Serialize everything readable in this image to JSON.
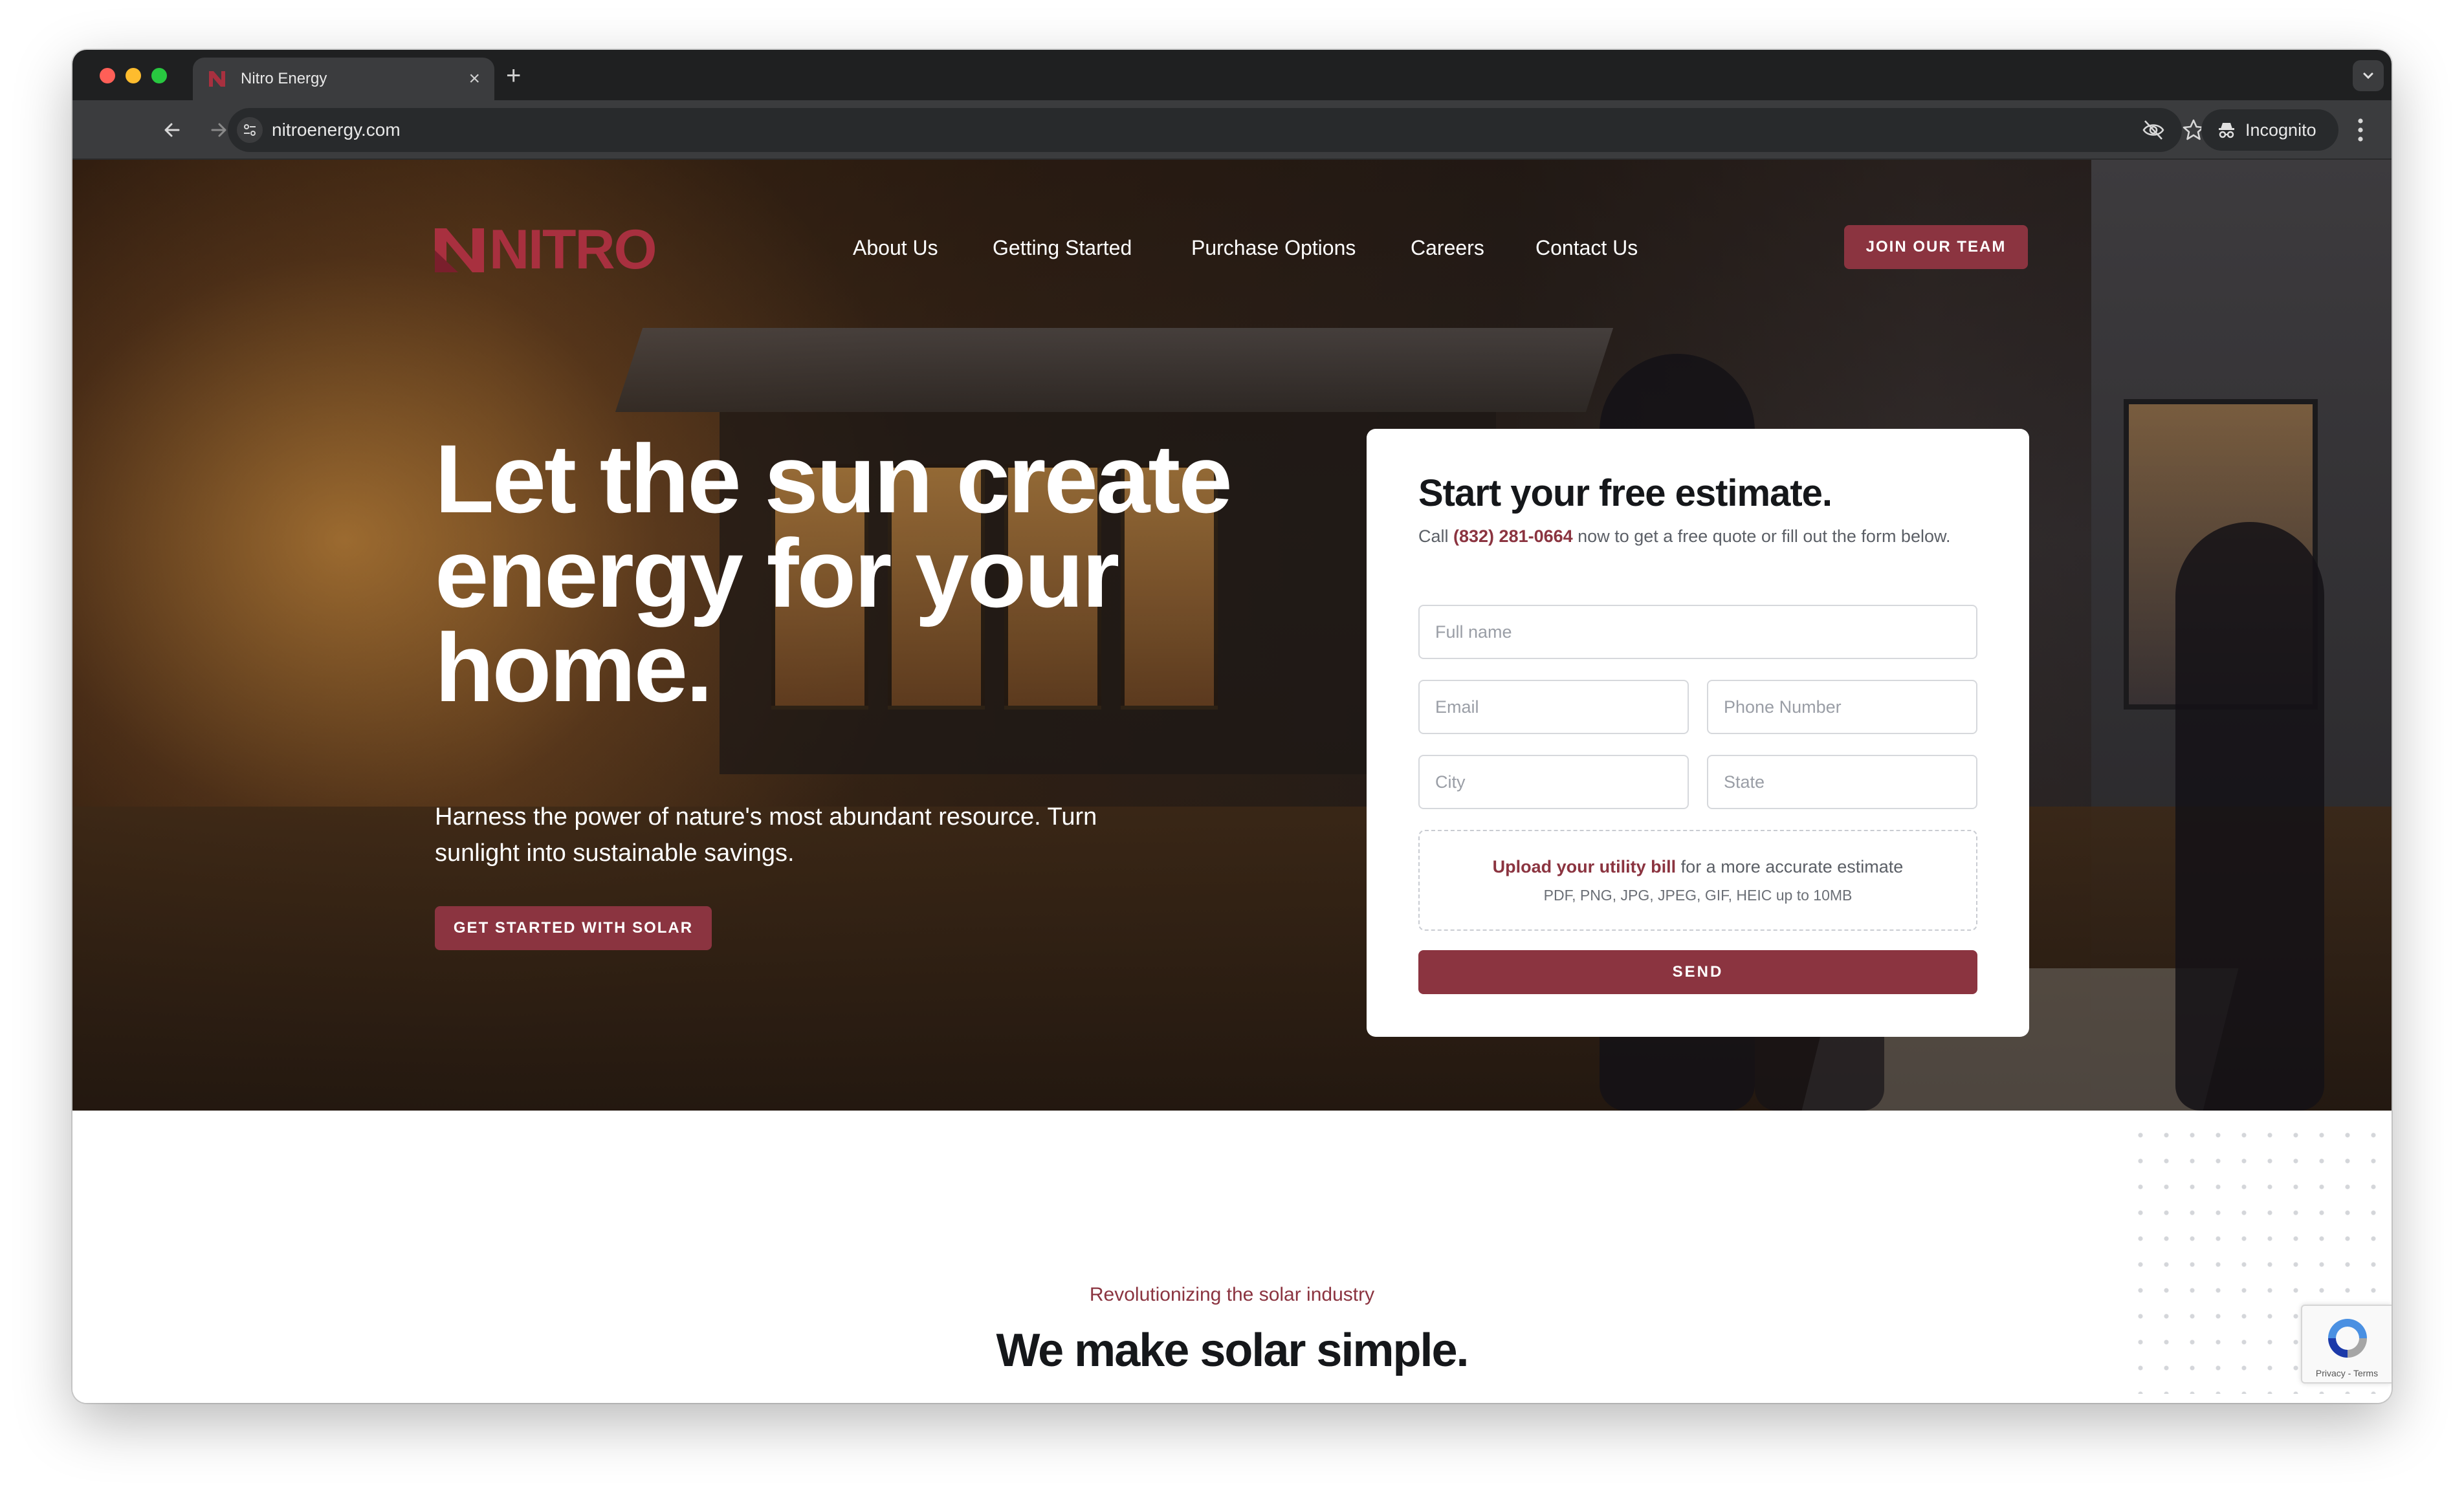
{
  "browser": {
    "tab_title": "Nitro Energy",
    "url": "nitroenergy.com",
    "incognito_label": "Incognito",
    "new_tab_symbol": "+",
    "close_symbol": "×"
  },
  "site": {
    "logo_text": "NITRO",
    "brand_color": "#8b3440",
    "nav": {
      "about": "About Us",
      "getting_started": "Getting Started",
      "purchase_options": "Purchase Options",
      "careers": "Careers",
      "contact": "Contact Us"
    },
    "join_button": "JOIN OUR TEAM"
  },
  "hero": {
    "headline": "Let the sun create energy for your home.",
    "subtext": "Harness the power of nature's most abundant resource. Turn sunlight into sustainable savings.",
    "cta": "GET STARTED WITH SOLAR"
  },
  "form": {
    "title": "Start your free estimate.",
    "desc_prefix": "Call ",
    "phone": "(832) 281-0664",
    "desc_suffix": " now to get a free quote or fill out the form below.",
    "placeholders": {
      "full_name": "Full name",
      "email": "Email",
      "phone": "Phone Number",
      "city": "City",
      "state": "State"
    },
    "upload_link": "Upload your utility bill",
    "upload_suffix": " for a more accurate estimate",
    "upload_formats": "PDF, PNG, JPG, JPEG, GIF, HEIC up to 10MB",
    "send": "SEND"
  },
  "section": {
    "eyebrow": "Revolutionizing the solar industry",
    "title": "We make solar simple."
  },
  "recaptcha": {
    "text": "Privacy - Terms"
  },
  "icons": [
    "back-arrow-icon",
    "forward-arrow-icon",
    "reload-icon",
    "site-info-icon",
    "eye-off-icon",
    "star-icon",
    "incognito-icon",
    "kebab-menu-icon",
    "chevron-down-icon",
    "nitro-logo-icon",
    "recaptcha-icon"
  ]
}
